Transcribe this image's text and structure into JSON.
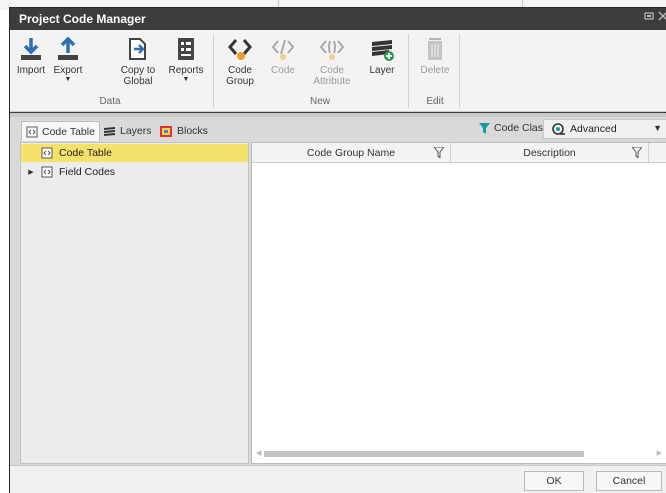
{
  "window": {
    "title": "Project Code Manager"
  },
  "ribbon": {
    "groups": {
      "data": "Data",
      "new": "New",
      "edit": "Edit"
    },
    "buttons": {
      "import": "Import",
      "export": "Export",
      "copy_to_global": "Copy to Global",
      "reports": "Reports",
      "code_group": "Code Group",
      "code": "Code",
      "code_attribute": "Code Attribute",
      "layer": "Layer",
      "delete": "Delete"
    }
  },
  "tabs": {
    "code_table": "Code Table",
    "layers": "Layers",
    "blocks": "Blocks"
  },
  "filter": {
    "code_class": "Code Class",
    "mode": "Advanced"
  },
  "tree": {
    "items": [
      "Code Table",
      "Field Codes"
    ]
  },
  "grid": {
    "columns": [
      "Code Group Name",
      "Description"
    ]
  },
  "footer": {
    "ok": "OK",
    "cancel": "Cancel"
  },
  "colors": {
    "accent_yellow": "#f5e26b",
    "filter_teal": "#1a9a9a",
    "title_bar": "#3c3c3c"
  }
}
